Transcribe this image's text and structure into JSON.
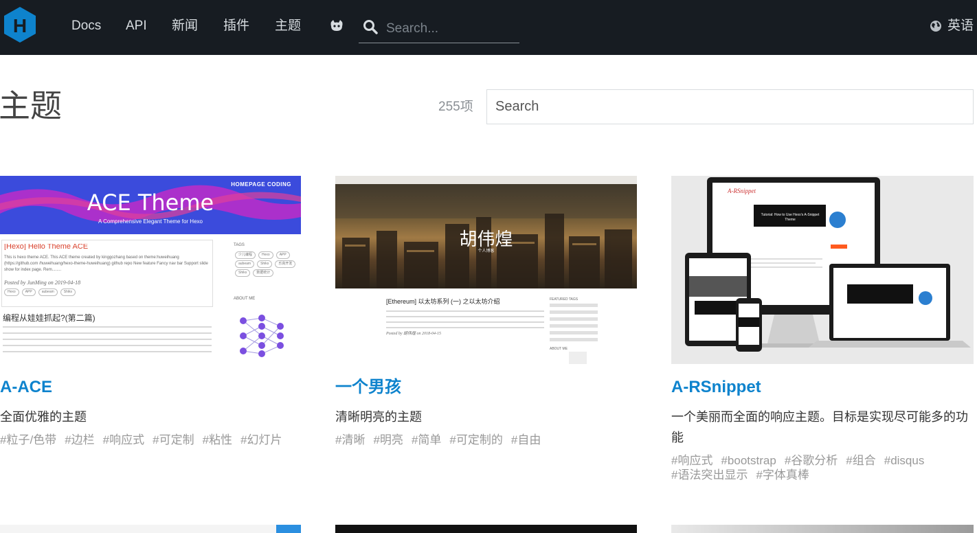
{
  "header": {
    "nav": [
      "Docs",
      "API",
      "新闻",
      "插件",
      "主题"
    ],
    "search_placeholder": "Search...",
    "language": "英语"
  },
  "page": {
    "title": "主题",
    "count": "255项",
    "filter_placeholder": "Search"
  },
  "themes": [
    {
      "name": "A-ACE",
      "description": "全面优雅的主题",
      "tags": [
        "#粒子/色带",
        "#边栏",
        "#响应式",
        "#可定制",
        "#粘性",
        "#幻灯片"
      ],
      "preview": {
        "nav": "HOMEPAGE    CODING",
        "title": "ACE Theme",
        "subtitle": "A Comprehensive Elegant Theme for Hexo",
        "post_title": "[Hexo] Hello Theme ACE",
        "post_excerpt": "This is hexo theme ACE. This ACE theme created by kinggozhang based on theme:huweihuang (https://github.com /huweihuang/hexo-theme-huweihuang) github repo New feature Fancy nav bar Support slide show for index page. Rem........",
        "post_meta": "Posted by JunMing on 2019-04-18",
        "post_tags": [
          "Hexo",
          "APP",
          "aubeam",
          "Shiks"
        ],
        "post2_title": "编程从娃娃抓起?(第二篇)",
        "sidebar_tags": "TAGS",
        "sidebar_about": "ABOUT ME",
        "tag_pills": [
          "少儿编程",
          "Hexo",
          "APP",
          "aubeam",
          "Shiks",
          "乐高开发",
          "Shiks",
          "数据统计"
        ]
      }
    },
    {
      "name": "一个男孩",
      "description": "清晰明亮的主题",
      "tags": [
        "#清晰",
        "#明亮",
        "#简单",
        "#可定制的",
        "#自由"
      ],
      "preview": {
        "title": "胡伟煌",
        "subtitle": "个人博客",
        "post_title": "[Ethereum] 以太坊系列 (一) 之以太坊介绍",
        "post_meta": "Posted by 胡伟煌 on 2018-04-15",
        "featured": "FEATURED TAGS",
        "about": "ABOUT ME"
      }
    },
    {
      "name": "A-RSnippet",
      "description": "一个美丽而全面的响应主题。目标是实现尽可能多的功能",
      "tags": [
        "#响应式",
        "#bootstrap",
        "#谷歌分析",
        "#组合",
        "#disqus",
        "#语法突出显示",
        "#字体真棒"
      ],
      "preview": {
        "brand": "A-RSnippet",
        "tutorial": "Tutorial: How to Use Hexo's A-Snippet Theme"
      }
    }
  ],
  "colors": {
    "header_bg": "#171c22",
    "link": "#0e83cd",
    "logo": "#0e83cd"
  }
}
